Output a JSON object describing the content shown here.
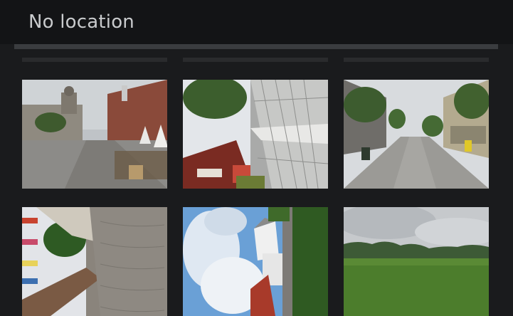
{
  "header": {
    "title": "No location"
  },
  "photos": [
    {
      "subject": "town-square-cobblestone"
    },
    {
      "subject": "rotated-street-cafe"
    },
    {
      "subject": "pedestrian-street-trees"
    },
    {
      "subject": "rotated-street-flags"
    },
    {
      "subject": "rotated-sky-houses"
    },
    {
      "subject": "green-field-cloudy"
    }
  ]
}
